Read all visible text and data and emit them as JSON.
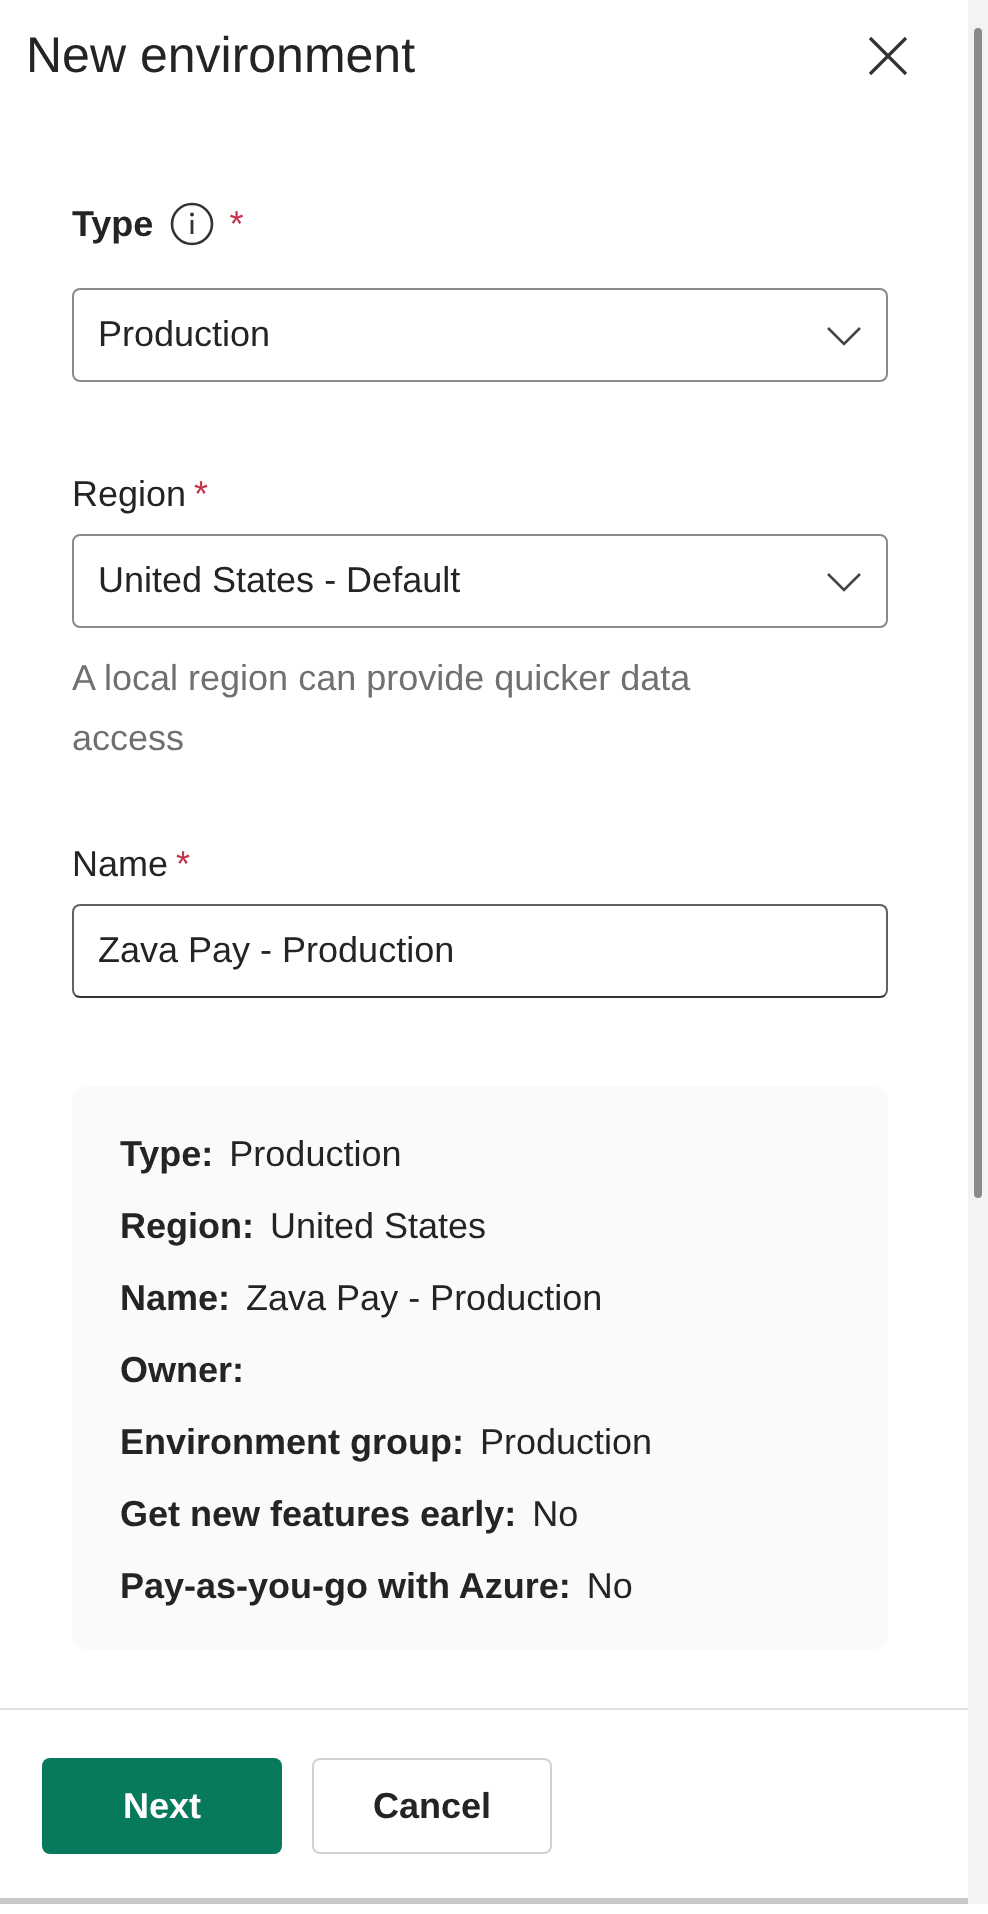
{
  "panel": {
    "title": "New environment"
  },
  "fields": [
    {
      "kind": "dropdown",
      "label": "Type",
      "required_mark": "*",
      "info": true,
      "value": "Production"
    },
    {
      "kind": "dropdown",
      "label": "Region",
      "required_mark": "*",
      "info": false,
      "value": "United States - Default",
      "help": "A local region can provide quicker data access"
    },
    {
      "kind": "text",
      "label": "Name",
      "required_mark": "*",
      "info": false,
      "value": "Zava Pay - Production"
    }
  ],
  "summary": [
    {
      "label": "Type:",
      "value": "Production"
    },
    {
      "label": "Region:",
      "value": "United States"
    },
    {
      "label": "Name:",
      "value": "Zava Pay - Production"
    },
    {
      "label": "Owner:"
    },
    {
      "label": "Environment group:",
      "value": "Production"
    },
    {
      "label": "Get new features early:",
      "value": "No"
    },
    {
      "label": "Pay-as-you-go with Azure:",
      "value": "No"
    }
  ],
  "buttons": [
    {
      "label": "Next",
      "kind": "primary"
    },
    {
      "label": "Cancel",
      "kind": "secondary"
    }
  ]
}
